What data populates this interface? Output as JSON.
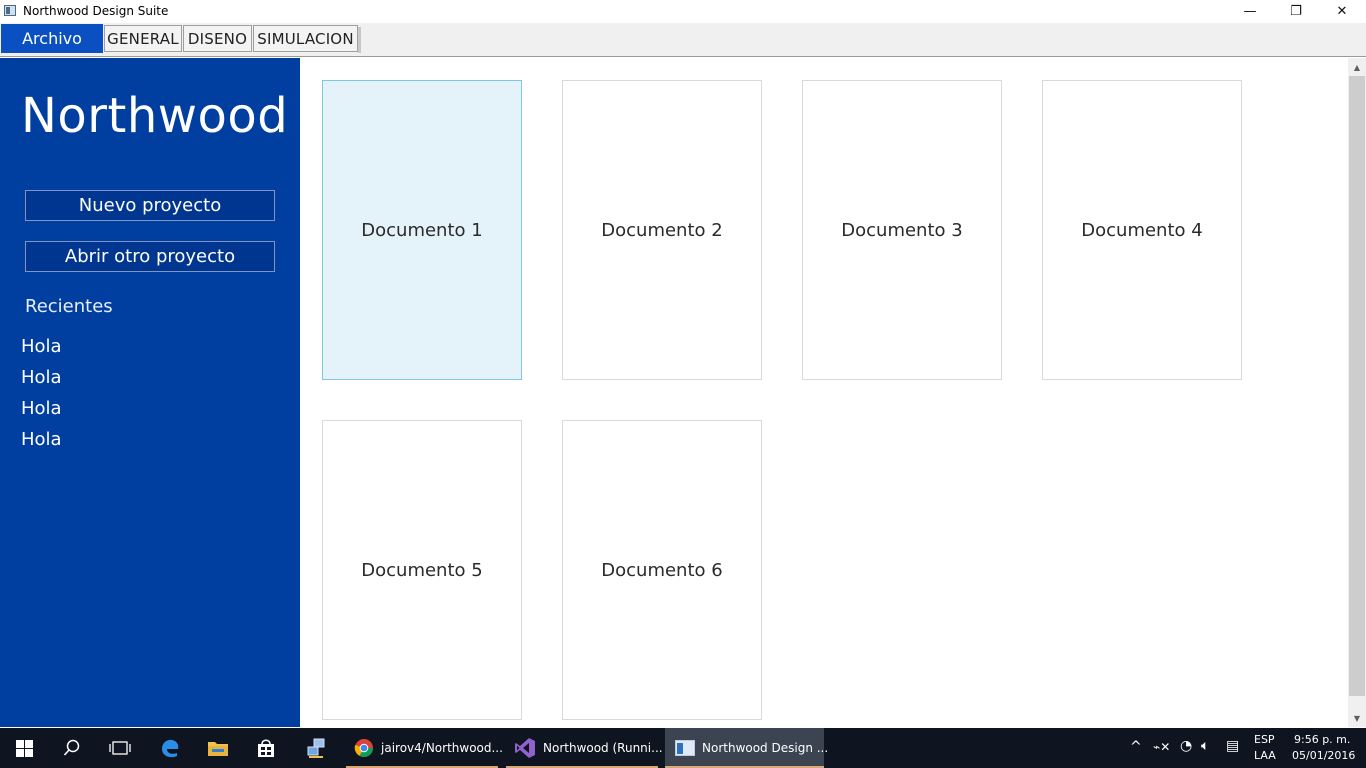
{
  "window": {
    "title": "Northwood Design Suite",
    "controls": {
      "minimize": "—",
      "restore": "❐",
      "close": "✕"
    }
  },
  "menu": {
    "archivo": "Archivo",
    "tabs": [
      "GENERAL",
      "DISENO",
      "SIMULACION"
    ]
  },
  "sidebar": {
    "brand": "Northwood",
    "new_project": "Nuevo proyecto",
    "open_project": "Abrir otro proyecto",
    "recent_heading": "Recientes",
    "recent_items": [
      "Hola",
      "Hola",
      "Hola",
      "Hola"
    ]
  },
  "documents": [
    "Documento 1",
    "Documento 2",
    "Documento 3",
    "Documento 4",
    "Documento 5",
    "Documento 6"
  ],
  "taskbar": {
    "apps": [
      {
        "label": "jairov4/Northwood...",
        "icon": "chrome-icon"
      },
      {
        "label": "Northwood (Runni...",
        "icon": "visual-studio-icon"
      },
      {
        "label": "Northwood Design ...",
        "icon": "northwood-app-icon"
      }
    ],
    "language": {
      "line1": "ESP",
      "line2": "LAA"
    },
    "time": "9:56 p. m.",
    "date": "05/01/2016"
  },
  "colors": {
    "sidebar": "#003fa0",
    "archivo_tab": "#0a50c2",
    "selected_card": "#e4f2f9",
    "selected_card_border": "#7ec6e2"
  }
}
